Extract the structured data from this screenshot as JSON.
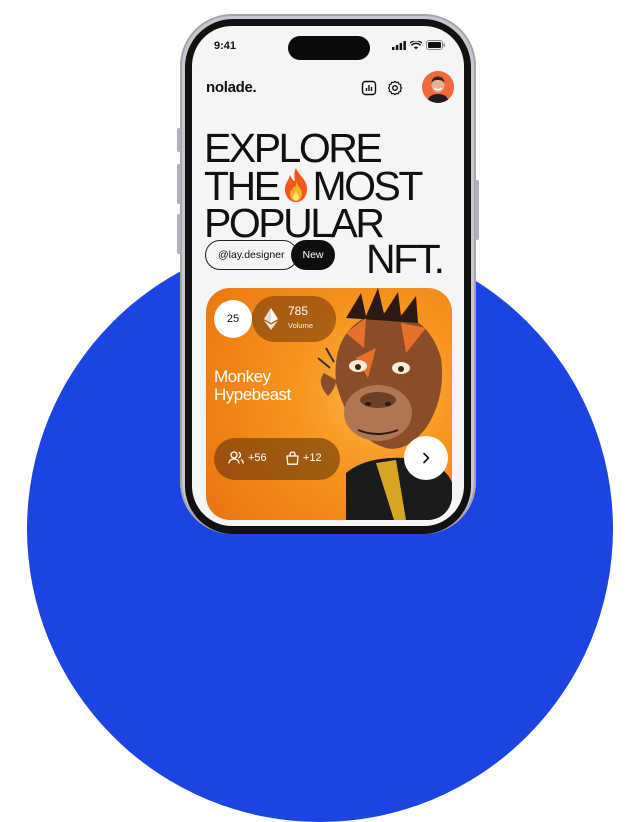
{
  "status_bar": {
    "time": "9:41"
  },
  "header": {
    "brand": "nolade."
  },
  "hero": {
    "line1": "EXPLORE",
    "line2a": "THE",
    "line2b": "MOST",
    "line3": "POPULAR",
    "line4": "NFT.",
    "username": "@lay.designer",
    "tag": "New"
  },
  "nft_card": {
    "rank": "25",
    "volume_value": "785",
    "volume_label": "Volume",
    "title_line1": "Monkey",
    "title_line2": "Hypebeast",
    "followers": "+56",
    "purchases": "+12"
  },
  "colors": {
    "accent_blue": "#1b44e3",
    "card_orange": "#f7941d",
    "avatar_bg": "#f06a3a"
  },
  "icons": [
    "signal-icon",
    "wifi-icon",
    "battery-icon",
    "chart-icon",
    "gear-icon",
    "fire-icon",
    "ethereum-icon",
    "users-icon",
    "bag-icon",
    "chevron-right-icon"
  ]
}
